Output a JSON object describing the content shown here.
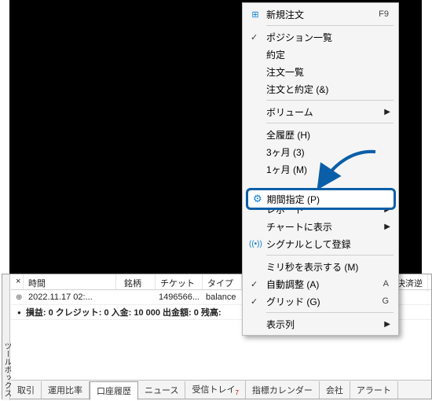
{
  "toolbox_label": "ツールボックス",
  "table": {
    "close": "×",
    "headers": {
      "time": "時間",
      "symbol": "銘柄",
      "ticket": "チケット",
      "type": "タイプ",
      "settle": "決済逆"
    },
    "row": {
      "time": "2022.11.17 02:...",
      "symbol": "",
      "ticket": "1496566...",
      "type": "balance"
    },
    "summary": "損益: 0  クレジット: 0  入金: 10 000  出金額: 0  残高:"
  },
  "tabs": {
    "t1": "取引",
    "t2": "運用比率",
    "t3": "口座履歴",
    "t4": "ニュース",
    "t5": "受信トレイ",
    "t5badge": "7",
    "t6": "指標カレンダー",
    "t7": "会社",
    "t8": "アラート"
  },
  "menu": {
    "new_order": "新規注文",
    "new_order_key": "F9",
    "positions": "ポジション一覧",
    "fills": "約定",
    "orders": "注文一覧",
    "orders_fills": "注文と約定 (&)",
    "volume": "ボリューム",
    "all_hist": "全履歴 (H)",
    "m3": "3ヶ月 (3)",
    "m1": "1ヶ月 (M)",
    "period": "期間指定 (P)",
    "report": "レポート",
    "chart_show": "チャートに表示",
    "signal": "シグナルとして登録",
    "ms": "ミリ秒を表示する (M)",
    "auto": "自動調整 (A)",
    "auto_key": "A",
    "grid": "グリッド (G)",
    "grid_key": "G",
    "cols": "表示列"
  }
}
